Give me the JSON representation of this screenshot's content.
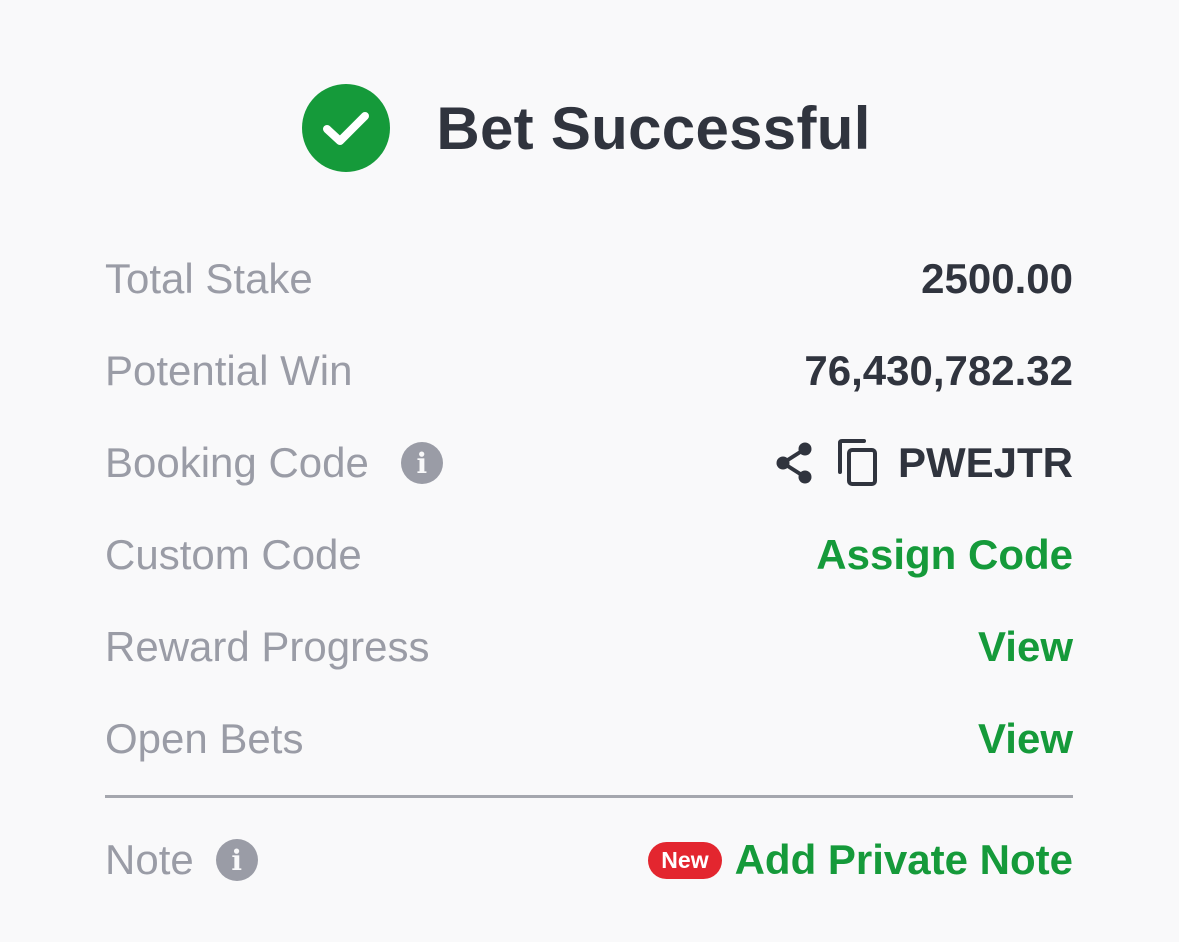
{
  "header": {
    "title": "Bet Successful",
    "icon": "check-circle-icon",
    "icon_color": "#159a3a"
  },
  "rows": {
    "total_stake": {
      "label": "Total Stake",
      "value": "2500.00"
    },
    "potential_win": {
      "label": "Potential Win",
      "value": "76,430,782.32"
    },
    "booking_code": {
      "label": "Booking Code",
      "info_glyph": "i",
      "value": "PWEJTR"
    },
    "custom_code": {
      "label": "Custom Code",
      "action": "Assign Code"
    },
    "reward_progress": {
      "label": "Reward Progress",
      "action": "View"
    },
    "open_bets": {
      "label": "Open Bets",
      "action": "View"
    }
  },
  "note": {
    "label": "Note",
    "info_glyph": "i",
    "badge": "New",
    "action": "Add Private Note"
  },
  "colors": {
    "accent": "#159a3a",
    "badge": "#e3262f",
    "label": "#9a9ca6",
    "value": "#30343e"
  }
}
